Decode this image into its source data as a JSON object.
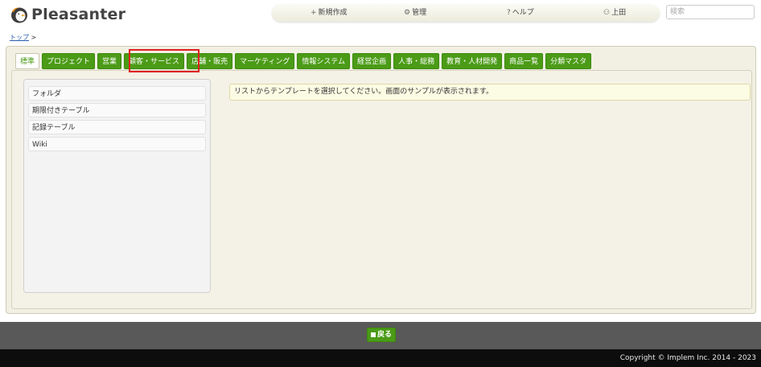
{
  "header": {
    "logo_text": "Pleasanter",
    "nav": [
      {
        "icon": "plus-icon",
        "glyph": "+",
        "label": "新規作成"
      },
      {
        "icon": "gear-icon",
        "glyph": "⚙",
        "label": "管理"
      },
      {
        "icon": "help-icon",
        "glyph": "?",
        "label": "ヘルプ"
      },
      {
        "icon": "user-icon",
        "glyph": "⚇",
        "label": "上田"
      }
    ],
    "search_placeholder": "検索"
  },
  "breadcrumb": {
    "top": "トップ",
    "separator": ">"
  },
  "tabs": [
    {
      "label": "標準",
      "active": true
    },
    {
      "label": "プロジェクト"
    },
    {
      "label": "営業"
    },
    {
      "label": "顧客・サービス"
    },
    {
      "label": "店舗・販売"
    },
    {
      "label": "マーケティング"
    },
    {
      "label": "情報システム"
    },
    {
      "label": "経営企画"
    },
    {
      "label": "人事・総務"
    },
    {
      "label": "教育・人材開発"
    },
    {
      "label": "商品一覧"
    },
    {
      "label": "分類マスタ"
    }
  ],
  "templates": [
    {
      "label": "フォルダ"
    },
    {
      "label": "期限付きテーブル"
    },
    {
      "label": "記録テーブル"
    },
    {
      "label": "Wiki"
    }
  ],
  "message": "リストからテンプレートを選択してください。画面のサンプルが表示されます。",
  "footer": {
    "back_label": "戻る",
    "copyright": "Copyright © Implem Inc. 2014 - 2023"
  },
  "colors": {
    "accent": "#4b9b17",
    "highlight": "#e0211f",
    "panel": "#f2f0e3"
  }
}
